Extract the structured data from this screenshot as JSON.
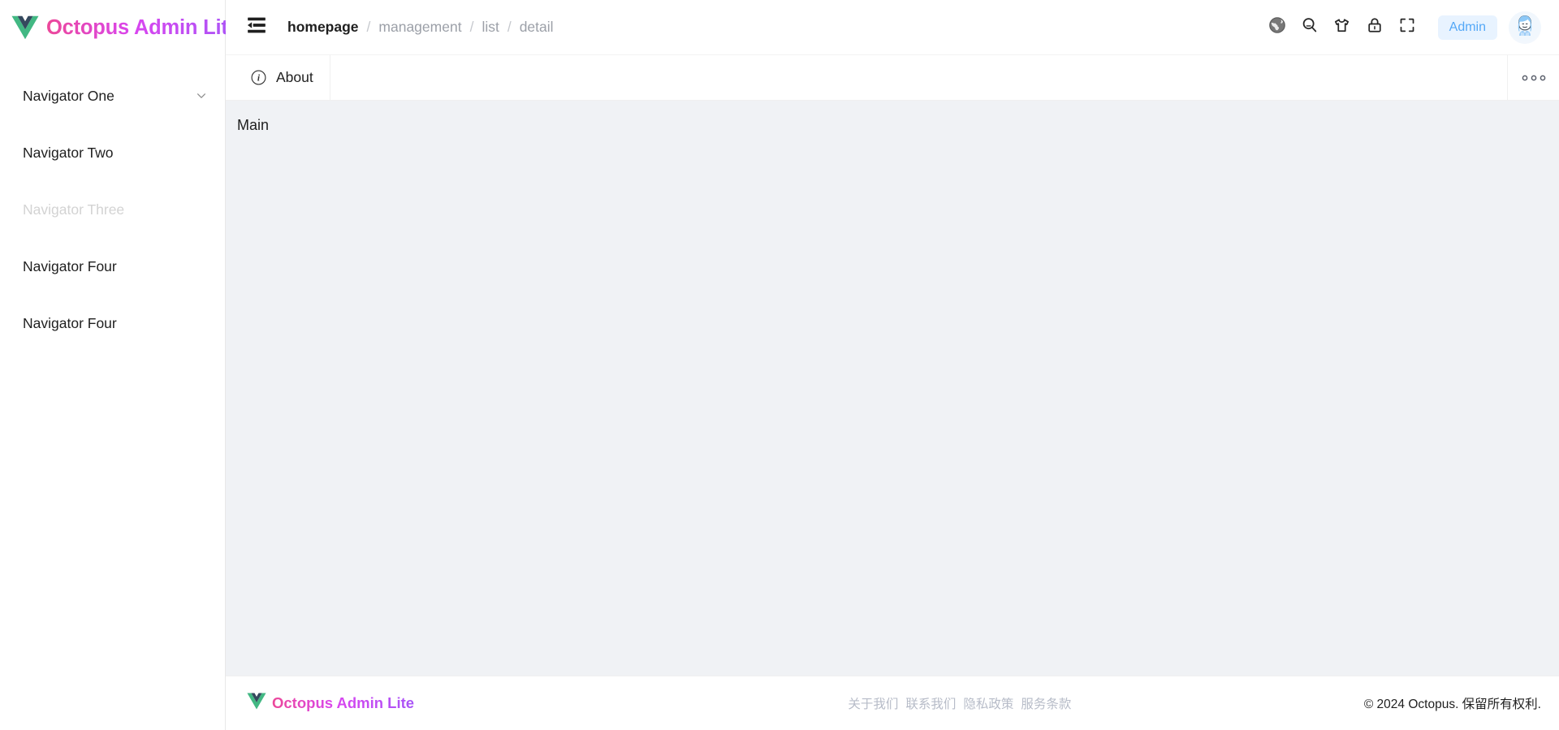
{
  "brand": {
    "name": "Octopus Admin Lite",
    "logo_icon": "vue-logo-icon",
    "gradient_from": "#ec4899",
    "gradient_to": "#a855f7"
  },
  "sidebar": {
    "items": [
      {
        "label": "Navigator One",
        "icon": "chevron-down-icon",
        "expandable": true,
        "disabled": false
      },
      {
        "label": "Navigator Two",
        "icon": "",
        "expandable": false,
        "disabled": false
      },
      {
        "label": "Navigator Three",
        "icon": "",
        "expandable": false,
        "disabled": true
      },
      {
        "label": "Navigator Four",
        "icon": "",
        "expandable": false,
        "disabled": false
      },
      {
        "label": "Navigator Four",
        "icon": "",
        "expandable": false,
        "disabled": false
      }
    ]
  },
  "header": {
    "fold_icon": "menu-fold-icon",
    "breadcrumb": [
      {
        "label": "homepage",
        "active": true
      },
      {
        "label": "management",
        "active": false
      },
      {
        "label": "list",
        "active": false
      },
      {
        "label": "detail",
        "active": false
      }
    ],
    "separator": "/",
    "actions": [
      {
        "icon": "globe-icon"
      },
      {
        "icon": "search-icon"
      },
      {
        "icon": "tshirt-icon"
      },
      {
        "icon": "lock-icon"
      },
      {
        "icon": "fullscreen-icon"
      }
    ],
    "admin_badge": "Admin",
    "admin_badge_bg": "#e8f3ff",
    "admin_badge_color": "#54a8f7",
    "avatar_icon": "user-avatar"
  },
  "tabbar": {
    "tabs": [
      {
        "label": "About",
        "icon": "info-circle-icon",
        "active": true
      }
    ],
    "more_icon": "ellipsis-icon"
  },
  "main": {
    "text": "Main",
    "background": "#f0f2f5"
  },
  "footer": {
    "brand": "Octopus Admin Lite",
    "links": [
      "关于我们",
      "联系我们",
      "隐私政策",
      "服务条款"
    ],
    "copyright": "© 2024 Octopus. 保留所有权利."
  }
}
